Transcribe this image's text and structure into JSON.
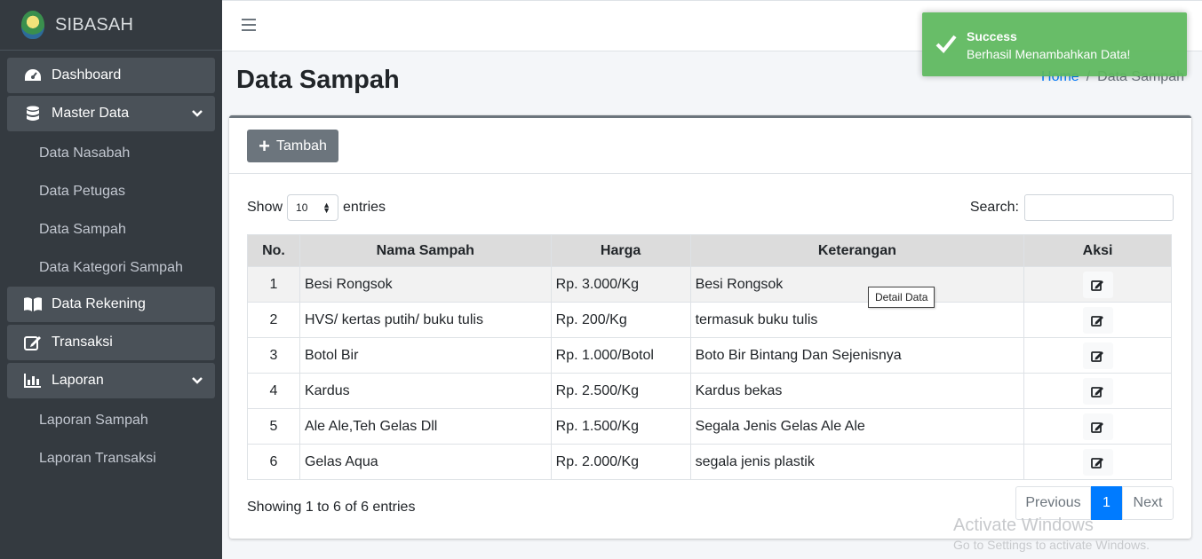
{
  "brand": {
    "name": "SIBASAH"
  },
  "sidebar": {
    "dashboard": "Dashboard",
    "master_data": "Master Data",
    "master_items": [
      "Data Nasabah",
      "Data Petugas",
      "Data Sampah",
      "Data Kategori Sampah"
    ],
    "rekening": "Data Rekening",
    "transaksi": "Transaksi",
    "laporan": "Laporan",
    "laporan_items": [
      "Laporan Sampah",
      "Laporan Transaksi"
    ]
  },
  "header": {
    "title": "Data Sampah",
    "breadcrumb_home": "Home",
    "breadcrumb_sep": "/",
    "breadcrumb_current": "Data Sampah"
  },
  "card": {
    "add_button": "Tambah",
    "show_label": "Show",
    "entries_select": "10",
    "entries_label": "entries",
    "search_label": "Search:",
    "columns": [
      "No.",
      "Nama Sampah",
      "Harga",
      "Keterangan",
      "Aksi"
    ],
    "rows": [
      {
        "no": "1",
        "nama": "Besi Rongsok",
        "harga": "Rp. 3.000/Kg",
        "keterangan": "Besi Rongsok"
      },
      {
        "no": "2",
        "nama": "HVS/ kertas putih/ buku tulis",
        "harga": "Rp. 200/Kg",
        "keterangan": "termasuk buku tulis"
      },
      {
        "no": "3",
        "nama": "Botol Bir",
        "harga": "Rp. 1.000/Botol",
        "keterangan": "Boto Bir Bintang Dan Sejenisnya"
      },
      {
        "no": "4",
        "nama": "Kardus",
        "harga": "Rp. 2.500/Kg",
        "keterangan": "Kardus bekas"
      },
      {
        "no": "5",
        "nama": "Ale Ale,Teh Gelas Dll",
        "harga": "Rp. 1.500/Kg",
        "keterangan": "Segala Jenis Gelas Ale Ale"
      },
      {
        "no": "6",
        "nama": "Gelas Aqua",
        "harga": "Rp. 2.000/Kg",
        "keterangan": "segala jenis plastik"
      }
    ],
    "tooltip": "Detail Data",
    "info": "Showing 1 to 6 of 6 entries",
    "pager": {
      "previous": "Previous",
      "current": "1",
      "next": "Next"
    }
  },
  "toast": {
    "title": "Success",
    "message": "Berhasil Menambahkan Data!"
  },
  "watermark": {
    "line1": "Activate Windows",
    "line2": "Go to Settings to activate Windows."
  },
  "colors": {
    "sidebar": "#343a40",
    "primary": "#007bff",
    "success": "#5cb85c",
    "secondary": "#6c757d"
  }
}
